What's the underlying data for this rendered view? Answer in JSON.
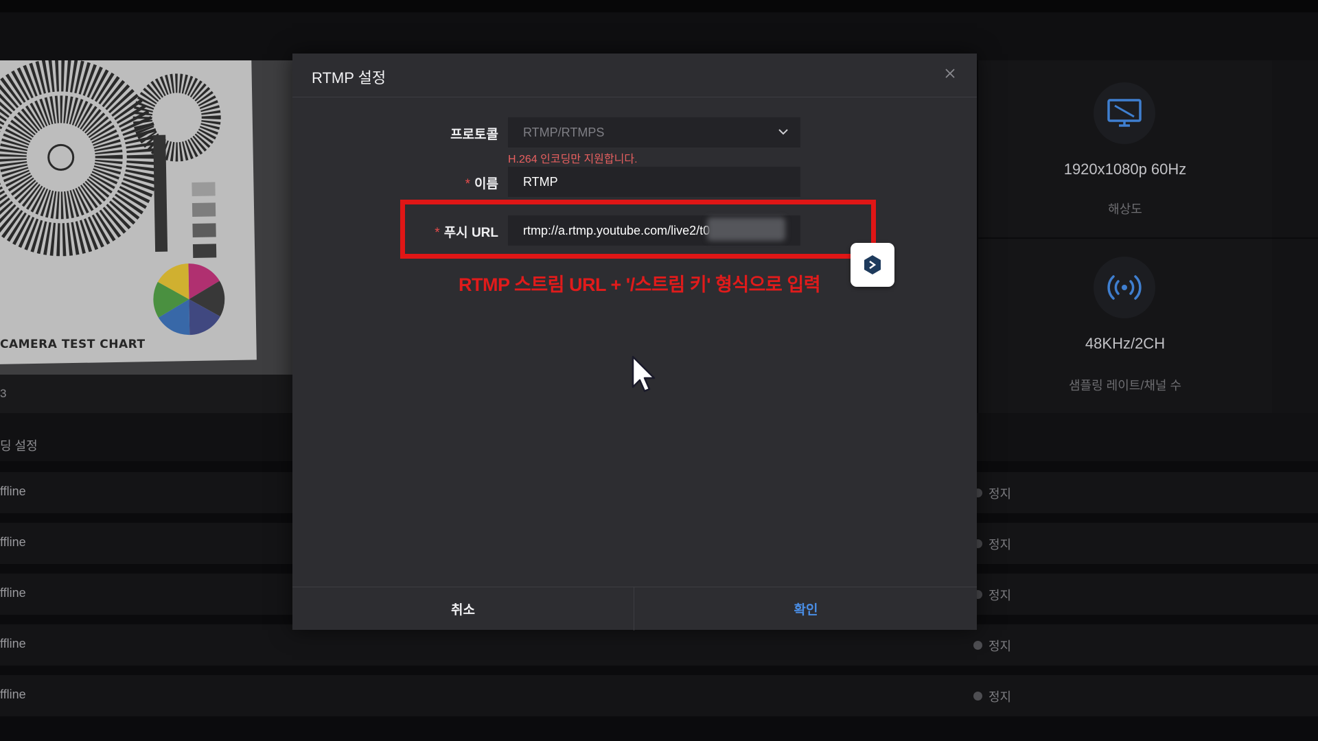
{
  "modal": {
    "title": "RTMP 설정",
    "protocol": {
      "label": "프로토콜",
      "value": "RTMP/RTMPS",
      "hint": "H.264 인코딩만 지원합니다."
    },
    "name": {
      "required_mark": "*",
      "label": "이름",
      "value": "RTMP"
    },
    "push_url": {
      "required_mark": "*",
      "label": "푸시 URL",
      "value": "rtmp://a.rtmp.youtube.com/live2/t0"
    },
    "annotation": "RTMP 스트림 URL + '/스트림 키' 형식으로 입력",
    "cancel_label": "취소",
    "ok_label": "확인"
  },
  "background": {
    "preview_caption": "CAMERA TEST CHART",
    "preview_footer": "3",
    "section_title": "딩 설정",
    "rows": [
      {
        "left": "ffline",
        "status": "정지"
      },
      {
        "left": "ffline",
        "status": "정지"
      },
      {
        "left": "ffline",
        "status": "정지"
      },
      {
        "left": "ffline",
        "status": "정지"
      },
      {
        "left": "ffline",
        "status": "정지"
      }
    ],
    "info_cards": [
      {
        "value": "1920x1080p 60Hz",
        "label": "해상도",
        "icon": "monitor-icon"
      },
      {
        "value": "48KHz/2CH",
        "label": "샘플링 레이트/채널 수",
        "icon": "broadcast-icon"
      }
    ]
  },
  "colors": {
    "accent": "#4a8fe8",
    "danger": "#e01616",
    "modal_bg": "#2d2d31"
  }
}
